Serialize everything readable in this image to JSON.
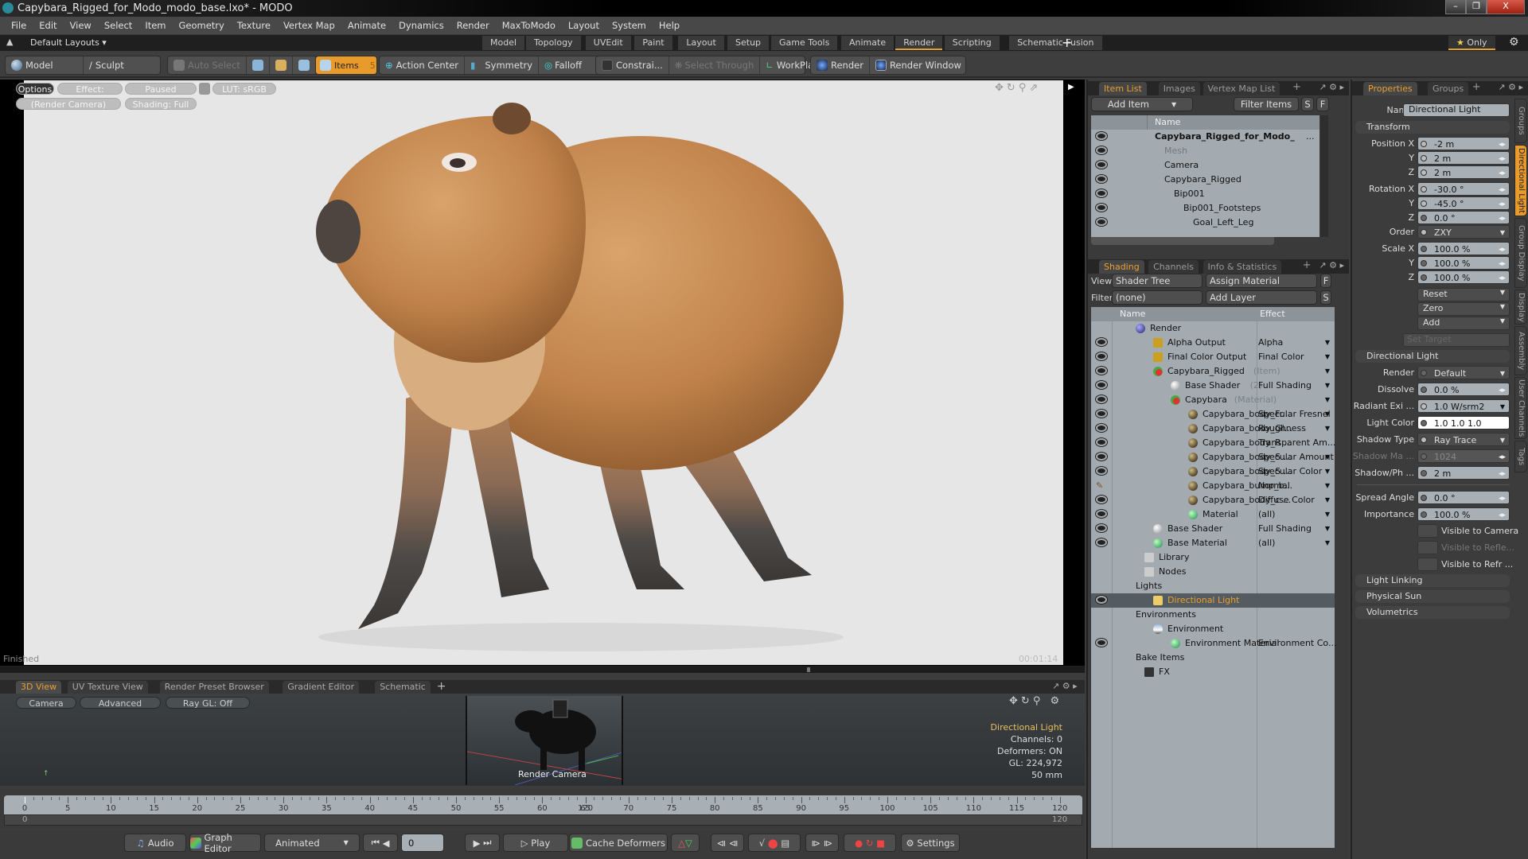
{
  "window": {
    "title": "Capybara_Rigged_for_Modo_modo_base.lxo* - MODO",
    "minimize": "–",
    "restore": "❐",
    "close": "X"
  },
  "menu": [
    "File",
    "Edit",
    "View",
    "Select",
    "Item",
    "Geometry",
    "Texture",
    "Vertex Map",
    "Animate",
    "Dynamics",
    "Render",
    "MaxToModo",
    "Layout",
    "System",
    "Help"
  ],
  "layout_bar": {
    "default_layouts": "Default Layouts ▾",
    "tabs": [
      "Model",
      "Topology",
      "UVEdit",
      "Paint",
      "Layout",
      "Setup",
      "Game Tools",
      "Animate",
      "Render",
      "Scripting",
      "Schematic Fusion"
    ],
    "active_tab": "Render",
    "add": "+",
    "only": "Only"
  },
  "toolbar": {
    "model": "Model",
    "sculpt": "Sculpt",
    "auto_select": "Auto Select",
    "items": "Items",
    "items_count": "5",
    "action_center": "Action Center",
    "symmetry": "Symmetry",
    "falloff": "Falloff",
    "constraints": "Constrai...",
    "select_through": "Select Through",
    "workplane": "WorkPlane",
    "render": "Render",
    "render_window": "Render Window"
  },
  "viewport": {
    "options": "Options",
    "effect": "Effect: (Shadi...",
    "paused": "Paused",
    "lut": "LUT: sRGB",
    "camera": "(Render Camera)",
    "shading": "Shading: Full",
    "status": "Finished",
    "timer": "00:01:14"
  },
  "bottom_tabs": [
    "3D View",
    "UV Texture View",
    "Render Preset Browser",
    "Gradient Editor",
    "Schematic"
  ],
  "view3d": {
    "camera": "Camera",
    "advanced": "Advanced",
    "raygl": "Ray GL: Off",
    "inset_label": "Render Camera",
    "info_title": "Directional Light",
    "channels": "Channels: 0",
    "deformers": "Deformers: ON",
    "gl": "GL: 224,972",
    "focal": "50 mm"
  },
  "timeline": {
    "ticks": [
      "0",
      "5",
      "10",
      "15",
      "20",
      "25",
      "30",
      "35",
      "40",
      "45",
      "50",
      "55",
      "60",
      "65",
      "70",
      "75",
      "80",
      "85",
      "90",
      "95",
      "100",
      "105",
      "110",
      "115",
      "120"
    ],
    "range_start": "0",
    "range_mid": "120",
    "range_end": "120"
  },
  "transport": {
    "audio": "Audio",
    "graph_editor": "Graph Editor",
    "animated": "Animated",
    "frame": "0",
    "play": "Play",
    "cache_deformers": "Cache Deformers",
    "settings": "Settings"
  },
  "item_list": {
    "tabs": [
      "Item List",
      "Images",
      "Vertex Map List"
    ],
    "add_item": "Add Item",
    "filter_items": "Filter Items",
    "s": "S",
    "f": "F",
    "col_name": "Name",
    "rows": [
      {
        "name": "Capybara_Rigged_for_Modo_",
        "suffix": "...",
        "level": 0,
        "bold": true
      },
      {
        "name": "Mesh",
        "level": 1,
        "dim": true
      },
      {
        "name": "Camera",
        "level": 1
      },
      {
        "name": "Capybara_Rigged",
        "level": 1
      },
      {
        "name": "Bip001",
        "level": 2
      },
      {
        "name": "Bip001_Footsteps",
        "level": 3
      },
      {
        "name": "Goal_Left_Leg",
        "level": 4
      }
    ]
  },
  "shading": {
    "tabs": [
      "Shading",
      "Channels",
      "Info & Statistics"
    ],
    "view_label": "View",
    "view_value": "Shader Tree",
    "assign_material": "Assign Material",
    "filter_label": "Filter",
    "filter_value": "(none)",
    "add_layer": "Add Layer",
    "f": "F",
    "s": "S",
    "col_name": "Name",
    "col_effect": "Effect",
    "rows": [
      {
        "name": "Render",
        "level": 0,
        "icon": "render",
        "eye": false,
        "effect": ""
      },
      {
        "name": "Alpha Output",
        "level": 1,
        "icon": "output",
        "eye": true,
        "effect": "Alpha",
        "dd": true
      },
      {
        "name": "Final Color Output",
        "level": 1,
        "icon": "output",
        "eye": true,
        "effect": "Final Color",
        "dd": true
      },
      {
        "name": "Capybara_Rigged",
        "tag": "(Item)",
        "level": 1,
        "icon": "mask",
        "eye": true,
        "effect": "",
        "dd": true
      },
      {
        "name": "Base Shader",
        "tag": "(2)",
        "level": 2,
        "icon": "shader",
        "eye": true,
        "effect": "Full Shading",
        "dd": true
      },
      {
        "name": "Capybara",
        "tag": "(Material)",
        "level": 2,
        "icon": "mask",
        "eye": true,
        "effect": "",
        "dd": true
      },
      {
        "name": "Capybara_body_Fr...",
        "level": 3,
        "icon": "texture",
        "eye": true,
        "effect": "Specular Fresnel",
        "dd": true
      },
      {
        "name": "Capybara_body_Gl...",
        "level": 3,
        "icon": "texture",
        "eye": true,
        "effect": "Roughness",
        "dd": true
      },
      {
        "name": "Capybara_body_R ...",
        "level": 3,
        "icon": "texture",
        "eye": true,
        "effect": "Transparent Am..."
      },
      {
        "name": "Capybara_body_S ...",
        "level": 3,
        "icon": "texture",
        "eye": true,
        "effect": "Specular Amount",
        "dd": true
      },
      {
        "name": "Capybara_body_S ...",
        "level": 3,
        "icon": "texture",
        "eye": true,
        "effect": "Specular Color",
        "dd": true
      },
      {
        "name": "Capybara_bump_b...",
        "level": 3,
        "icon": "texture",
        "eye": "brush",
        "effect": "Normal",
        "dd": true
      },
      {
        "name": "Capybara_body_c ...",
        "level": 3,
        "icon": "texture",
        "eye": true,
        "effect": "Diffuse Color",
        "dd": true
      },
      {
        "name": "Material",
        "level": 3,
        "icon": "material",
        "eye": true,
        "effect": "(all)",
        "dd": true
      },
      {
        "name": "Base Shader",
        "level": 1,
        "icon": "shader",
        "eye": true,
        "effect": "Full Shading",
        "dd": true
      },
      {
        "name": "Base Material",
        "level": 1,
        "icon": "material",
        "eye": true,
        "effect": "(all)",
        "dd": true
      },
      {
        "name": "Library",
        "level": 0.5,
        "icon": "folder",
        "eye": false,
        "effect": ""
      },
      {
        "name": "Nodes",
        "level": 0.5,
        "icon": "folder",
        "eye": false,
        "effect": ""
      },
      {
        "name": "Lights",
        "level": 0,
        "icon": "none",
        "eye": false,
        "effect": ""
      },
      {
        "name": "Directional Light",
        "level": 1,
        "icon": "light",
        "eye": true,
        "effect": "",
        "selected": true
      },
      {
        "name": "Environments",
        "level": 0,
        "icon": "none",
        "eye": false,
        "effect": ""
      },
      {
        "name": "Environment",
        "level": 1,
        "icon": "env",
        "eye": false,
        "effect": ""
      },
      {
        "name": "Environment Material",
        "level": 2,
        "icon": "material",
        "eye": true,
        "effect": "Environment Co..."
      },
      {
        "name": "Bake Items",
        "level": 0,
        "icon": "none",
        "eye": false,
        "effect": ""
      },
      {
        "name": "FX",
        "level": 0.5,
        "icon": "fx",
        "eye": false,
        "effect": ""
      }
    ]
  },
  "properties": {
    "tabs": [
      "Properties",
      "Groups"
    ],
    "name_label": "Name",
    "name_value": "Directional Light",
    "transform": "Transform",
    "rows": [
      {
        "label": "Position X",
        "value": "-2 m",
        "dot": true
      },
      {
        "label": "Y",
        "value": "2 m",
        "dot": true
      },
      {
        "label": "Z",
        "value": "2 m",
        "dot": true
      },
      {
        "label": "Rotation X",
        "value": "-30.0 °",
        "dot": true,
        "gap": true
      },
      {
        "label": "Y",
        "value": "-45.0 °",
        "dot": true
      },
      {
        "label": "Z",
        "value": "0.0 °"
      },
      {
        "label": "Order",
        "value": "ZXY",
        "dot": true,
        "dark": true,
        "dd": true
      },
      {
        "label": "Scale X",
        "value": "100.0 %",
        "gap": true
      },
      {
        "label": "Y",
        "value": "100.0 %"
      },
      {
        "label": "Z",
        "value": "100.0 %"
      }
    ],
    "reset": "Reset",
    "zero": "Zero",
    "add": "Add",
    "set_target": "Set Target",
    "light_section": "Directional Light",
    "light_rows": [
      {
        "label": "Render",
        "value": "Default",
        "dark": true,
        "dd": true
      },
      {
        "label": "Dissolve",
        "value": "0.0 %"
      },
      {
        "label": "Radiant Exi ...",
        "value": "1.0 W/srm2",
        "dot": true,
        "dd": true
      },
      {
        "label": "Light Color",
        "value": "1.0   1.0   1.0",
        "white": true
      },
      {
        "label": "Shadow Type",
        "value": "Ray Trace",
        "dot": true,
        "dark": true,
        "dd": true
      },
      {
        "label": "Shadow Ma ...",
        "value": "1024",
        "disabled": true
      },
      {
        "label": "Shadow/Ph ...",
        "value": "2 m"
      },
      {
        "label": "Spread Angle",
        "value": "0.0 °",
        "gap": true
      },
      {
        "label": "Importance",
        "value": "100.0 %"
      }
    ],
    "checks": [
      "Visible to Camera",
      "Visible to Refle...",
      "Visible to Refr ..."
    ],
    "sections": [
      "Light Linking",
      "Physical Sun",
      "Volumetrics"
    ],
    "side_tabs": [
      "Groups",
      "Directional Light",
      "Group Display",
      "Display",
      "Assembly",
      "User Channels",
      "Tags"
    ]
  },
  "colors": {
    "accent": "#e89a2a",
    "panel": "#a3abb1",
    "selected_text": "#e8a030"
  }
}
